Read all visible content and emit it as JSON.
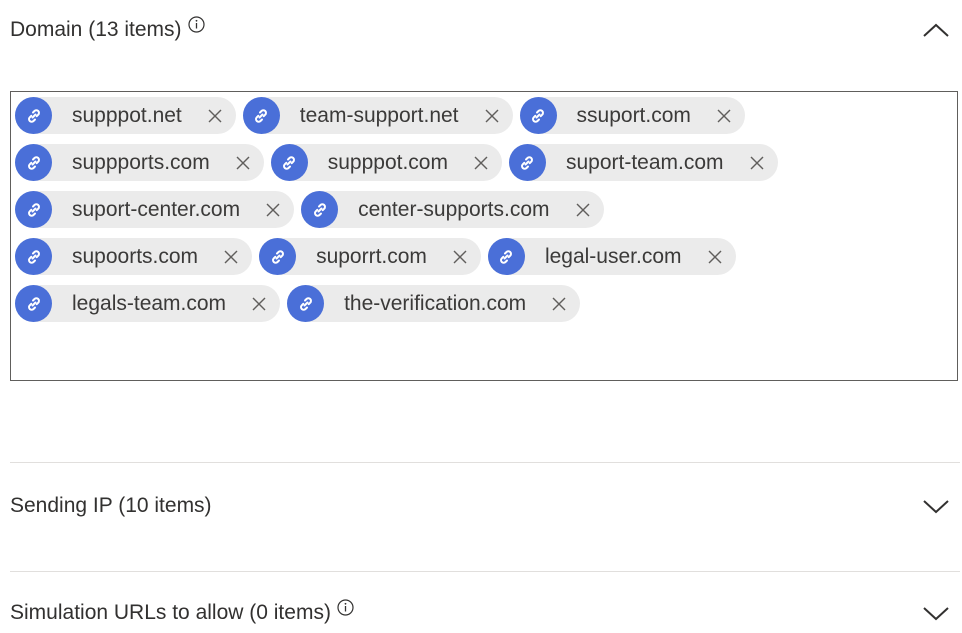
{
  "sections": {
    "domain": {
      "title": "Domain (13 items)",
      "rows": [
        [
          "supppot.net",
          "team-support.net",
          "ssuport.com"
        ],
        [
          "suppports.com",
          "supppot.com",
          "suport-team.com"
        ],
        [
          "suport-center.com",
          "center-supports.com"
        ],
        [
          "supoorts.com",
          "suporrt.com",
          "legal-user.com"
        ],
        [
          "legals-team.com",
          "the-verification.com"
        ]
      ],
      "chip_icon": "link-icon",
      "remove_icon": "close-icon",
      "collapse_icon": "chevron-up-icon"
    },
    "sending_ip": {
      "title": "Sending IP (10 items)",
      "expand_icon": "chevron-down-icon"
    },
    "simulation_urls": {
      "title": "Simulation URLs to allow (0 items)",
      "expand_icon": "chevron-down-icon"
    }
  },
  "colors": {
    "chip_icon_bg": "#4a6fd8",
    "chip_bg": "#ebebeb",
    "text": "#323130",
    "border": "#605e5c"
  }
}
